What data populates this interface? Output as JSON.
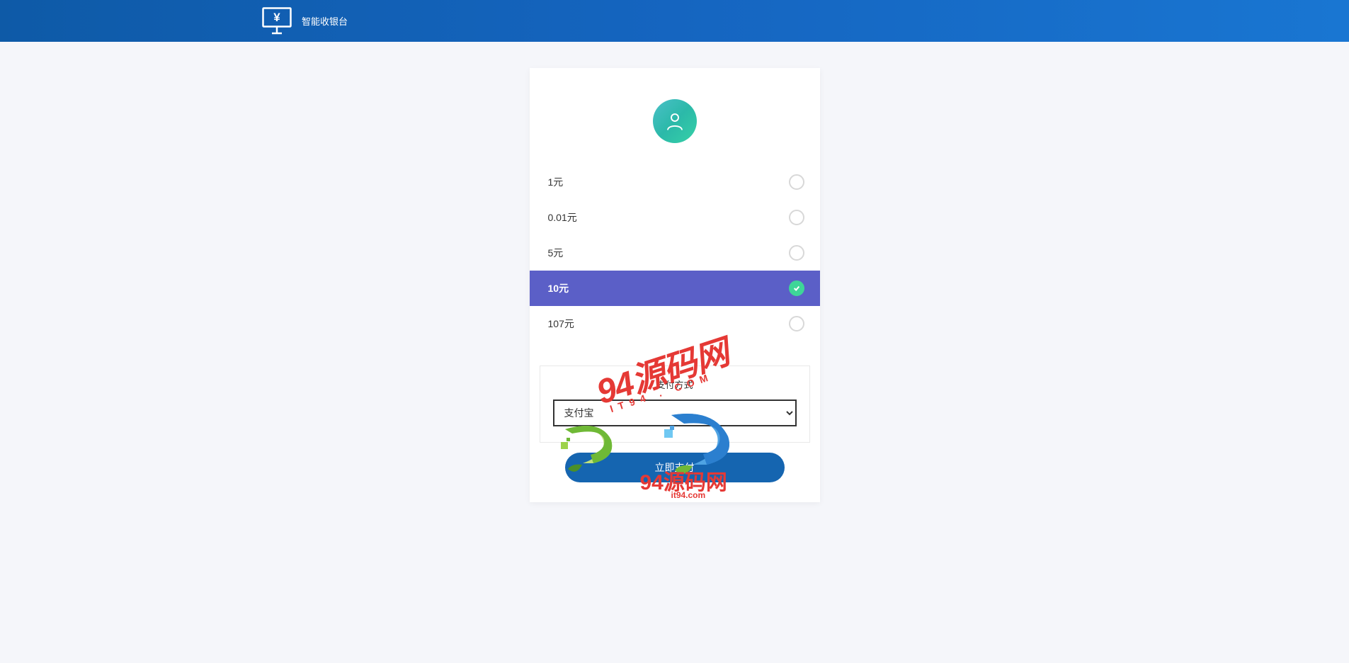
{
  "header": {
    "title": "智能收银台"
  },
  "amounts": {
    "items": [
      {
        "label": "1元",
        "selected": false
      },
      {
        "label": "0.01元",
        "selected": false
      },
      {
        "label": "5元",
        "selected": false
      },
      {
        "label": "10元",
        "selected": true
      },
      {
        "label": "107元",
        "selected": false
      }
    ]
  },
  "payment": {
    "title": "支付方式",
    "selected": "支付宝"
  },
  "submit": {
    "label": "立即支付"
  },
  "watermark": {
    "brand": "94源码网",
    "domain": "it94.com",
    "com_spaced": "IT94 . COM"
  }
}
